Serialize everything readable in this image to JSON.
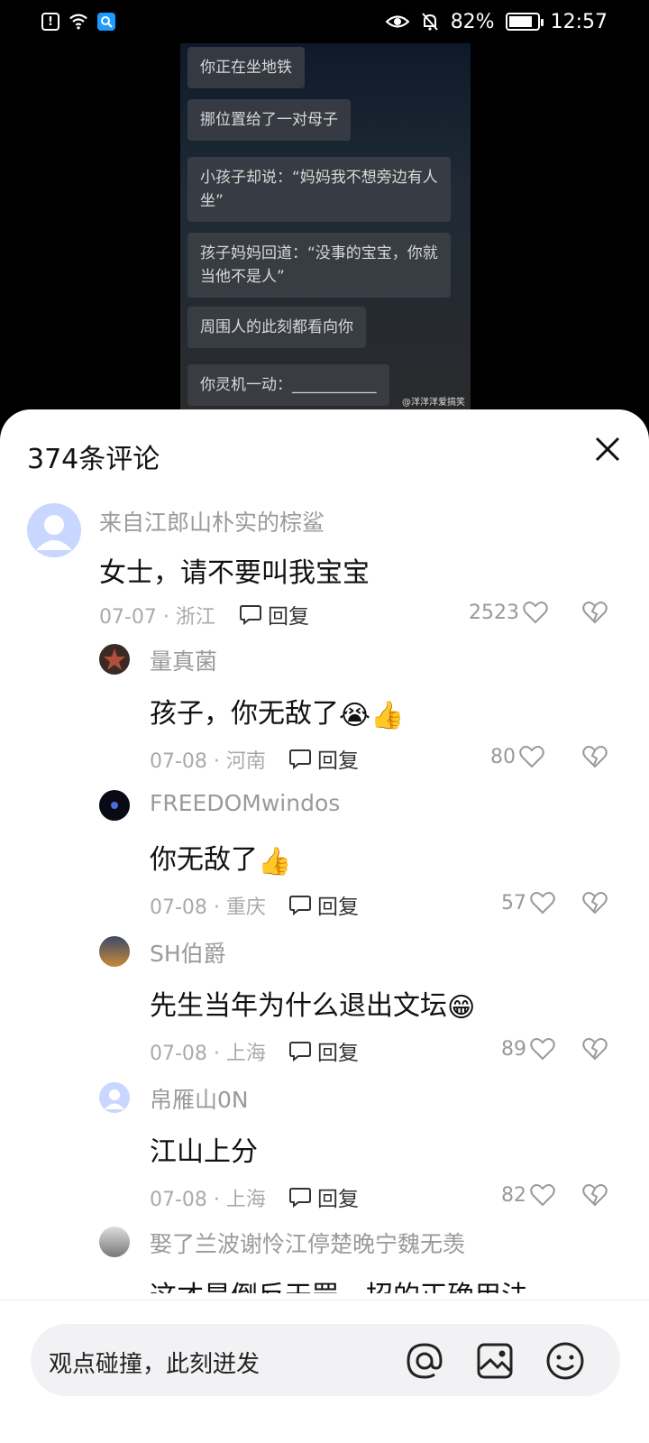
{
  "status_bar": {
    "battery": "82%",
    "battery_level": 0.82,
    "time": "12:57",
    "icons": [
      "alert-icon",
      "wifi-icon",
      "search-app-icon",
      "eye-icon",
      "bell-off-icon",
      "battery-icon"
    ]
  },
  "video": {
    "bubbles": [
      "你正在坐地铁",
      "挪位置给了一对母子",
      "小孩子却说：“妈妈我不想旁边有人\n坐”",
      "孩子妈妈回道：“没事的宝宝，你就\n当他不是人”",
      "周围人的此刻都看向你",
      "你灵机一动：___________"
    ],
    "watermark": "@洋洋洋爱搞笑"
  },
  "sheet": {
    "title": "374条评论",
    "comments": [
      {
        "user": "来自江郎山朴实的棕鲨",
        "text": "女士，请不要叫我宝宝",
        "emoji": "",
        "date": "07-07 · 浙江",
        "reply": "回复",
        "likes": "2523"
      },
      {
        "user": "量真菌",
        "text": "孩子，你无敌了",
        "emoji": "😭👍",
        "date": "07-08 · 河南",
        "reply": "回复",
        "likes": "80"
      },
      {
        "user": "FREEDOMwindos",
        "text": "你无敌了",
        "emoji": "👍",
        "date": "07-08 · 重庆",
        "reply": "回复",
        "likes": "57"
      },
      {
        "user": "SH伯爵",
        "text": "先生当年为什么退出文坛",
        "emoji": "😁",
        "date": "07-08 · 上海",
        "reply": "回复",
        "likes": "89"
      },
      {
        "user": "帛雁山0N",
        "text": "江山上分",
        "emoji": "",
        "date": "07-08 · 上海",
        "reply": "回复",
        "likes": "82"
      },
      {
        "user": "娶了兰波谢怜江停楚晚宁魏无羡",
        "text": "这才是倒反天罡一招的正确用法",
        "emoji": "",
        "date": "",
        "reply": "",
        "likes": ""
      }
    ]
  },
  "input": {
    "placeholder": "观点碰撞，此刻迸发"
  }
}
